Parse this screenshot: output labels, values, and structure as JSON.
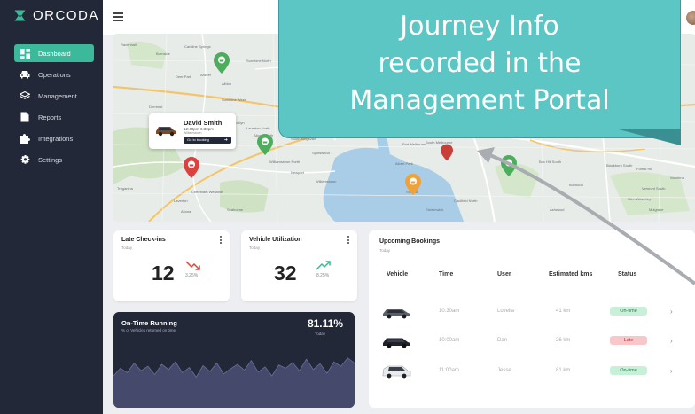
{
  "brand": {
    "name": "ORCODA",
    "color": "#3cb89a"
  },
  "sidebar": {
    "items": [
      {
        "label": "Dashboard",
        "icon": "grid-icon",
        "active": true
      },
      {
        "label": "Operations",
        "icon": "car-icon",
        "active": false
      },
      {
        "label": "Management",
        "icon": "layers-icon",
        "active": false
      },
      {
        "label": "Reports",
        "icon": "document-icon",
        "active": false
      },
      {
        "label": "Integrations",
        "icon": "puzzle-icon",
        "active": false
      },
      {
        "label": "Settings",
        "icon": "gear-icon",
        "active": false
      }
    ]
  },
  "map": {
    "labels": [
      "Ravenhall",
      "Burnside",
      "Caroline Springs",
      "Sunshine North",
      "Albion",
      "Ardeer",
      "Deer Park",
      "Derrimut",
      "Sunshine West",
      "Brooklyn",
      "Laverton North",
      "Altona North",
      "South Kingsville",
      "Spotswood",
      "Williamstown North",
      "Newport",
      "Williamstown",
      "Seaholme",
      "Altona",
      "Laverton",
      "Truganina",
      "Cheetham Wetlands",
      "Port Melbourne",
      "South Melbourne",
      "Albert Park",
      "St Kilda",
      "Caulfield North",
      "Elsternwick",
      "Box Hill South",
      "Blackburn South",
      "Forest Hill",
      "Burwood",
      "Ashwood",
      "Vermont South",
      "Wantirna",
      "Glen Waverley",
      "Mulgrave",
      "Albert Park"
    ],
    "driver": {
      "name": "David Smith",
      "time": "12:40pm-6:30pm",
      "place": "Williamstown",
      "button": "Go to booking"
    }
  },
  "callout": {
    "lines": [
      "Journey Info",
      "recorded in the",
      "Management Portal"
    ]
  },
  "cards": {
    "late_checkins": {
      "title": "Late Check-ins",
      "sub": "Today",
      "value": "12",
      "pct": "3.25%",
      "trend": "down"
    },
    "vehicle_util": {
      "title": "Vehicle Utilization",
      "sub": "Today",
      "value": "32",
      "pct": "8.25%",
      "trend": "up"
    },
    "ontime": {
      "title": "On-Time Running",
      "sub": "% of Vehicles returned on time",
      "value": "81.11%",
      "period": "Today"
    }
  },
  "bookings": {
    "title": "Upcoming Bookings",
    "sub": "Today",
    "headers": [
      "Vehicle",
      "Time",
      "User",
      "Estimated kms",
      "Status"
    ],
    "rows": [
      {
        "time": "10:30am",
        "user": "Lovella",
        "kms": "41 km",
        "status": "On-time",
        "kind": "ok",
        "vehicle_icon": "sedan-icon"
      },
      {
        "time": "10:00am",
        "user": "Dan",
        "kms": "26 km",
        "status": "Late",
        "kind": "late",
        "vehicle_icon": "sedan-black-icon"
      },
      {
        "time": "11:00am",
        "user": "Jesse",
        "kms": "81 km",
        "status": "On-time",
        "kind": "ok",
        "vehicle_icon": "suv-white-icon"
      }
    ]
  },
  "colors": {
    "sidebar": "#232838",
    "accent": "#3cb89a",
    "callout": "#5bc6c3",
    "late": "#f7c7ca",
    "ontime": "#c8f0d8"
  },
  "chart_data": {
    "type": "area",
    "title": "On-Time Running",
    "values": [
      50,
      62,
      55,
      70,
      58,
      65,
      52,
      68,
      60,
      72,
      55,
      63,
      48,
      66,
      57,
      70,
      53,
      61,
      68,
      59,
      74,
      56,
      64,
      50,
      67,
      62,
      71,
      58,
      76,
      60,
      69,
      54,
      72,
      65,
      78,
      70
    ]
  }
}
